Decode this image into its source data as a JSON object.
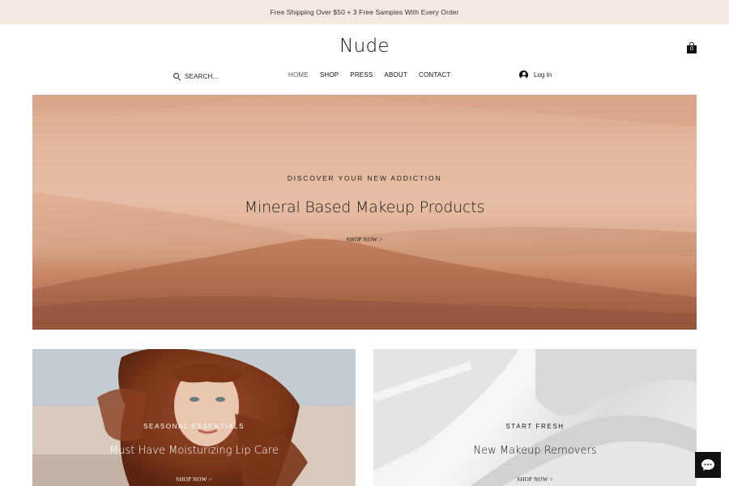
{
  "promo": {
    "text": "Free Shipping Over $50 + 3 Free Samples With Every Order"
  },
  "brand": {
    "name": "Nude"
  },
  "cart": {
    "count": "0",
    "icon": "shopping-bag-icon"
  },
  "search": {
    "placeholder": "SEARCH...",
    "icon": "search-icon"
  },
  "nav": {
    "items": [
      {
        "label": "HOME",
        "active": true
      },
      {
        "label": "SHOP"
      },
      {
        "label": "PRESS"
      },
      {
        "label": "ABOUT"
      },
      {
        "label": "CONTACT"
      }
    ]
  },
  "login": {
    "label": "Log In",
    "icon": "user-avatar-icon"
  },
  "hero": {
    "eyebrow": "DISCOVER YOUR NEW ADDICTION",
    "title": "Mineral Based Makeup Products",
    "cta": "SHOP NOW >"
  },
  "cards": [
    {
      "eyebrow": "SEASONAL ESSENTIALS",
      "title": "Must Have Moisturizing Lip Care",
      "cta": "SHOP NOW >"
    },
    {
      "eyebrow": "START FRESH",
      "title": "New Makeup Removers",
      "cta": "SHOP NOW >"
    }
  ],
  "chat": {
    "icon": "chat-bubble-icon"
  },
  "colors": {
    "promo_bg": "#f6e8e2",
    "sand_light": "#e7bea5",
    "sand_dark": "#a9664a",
    "text_dark": "#111111"
  }
}
